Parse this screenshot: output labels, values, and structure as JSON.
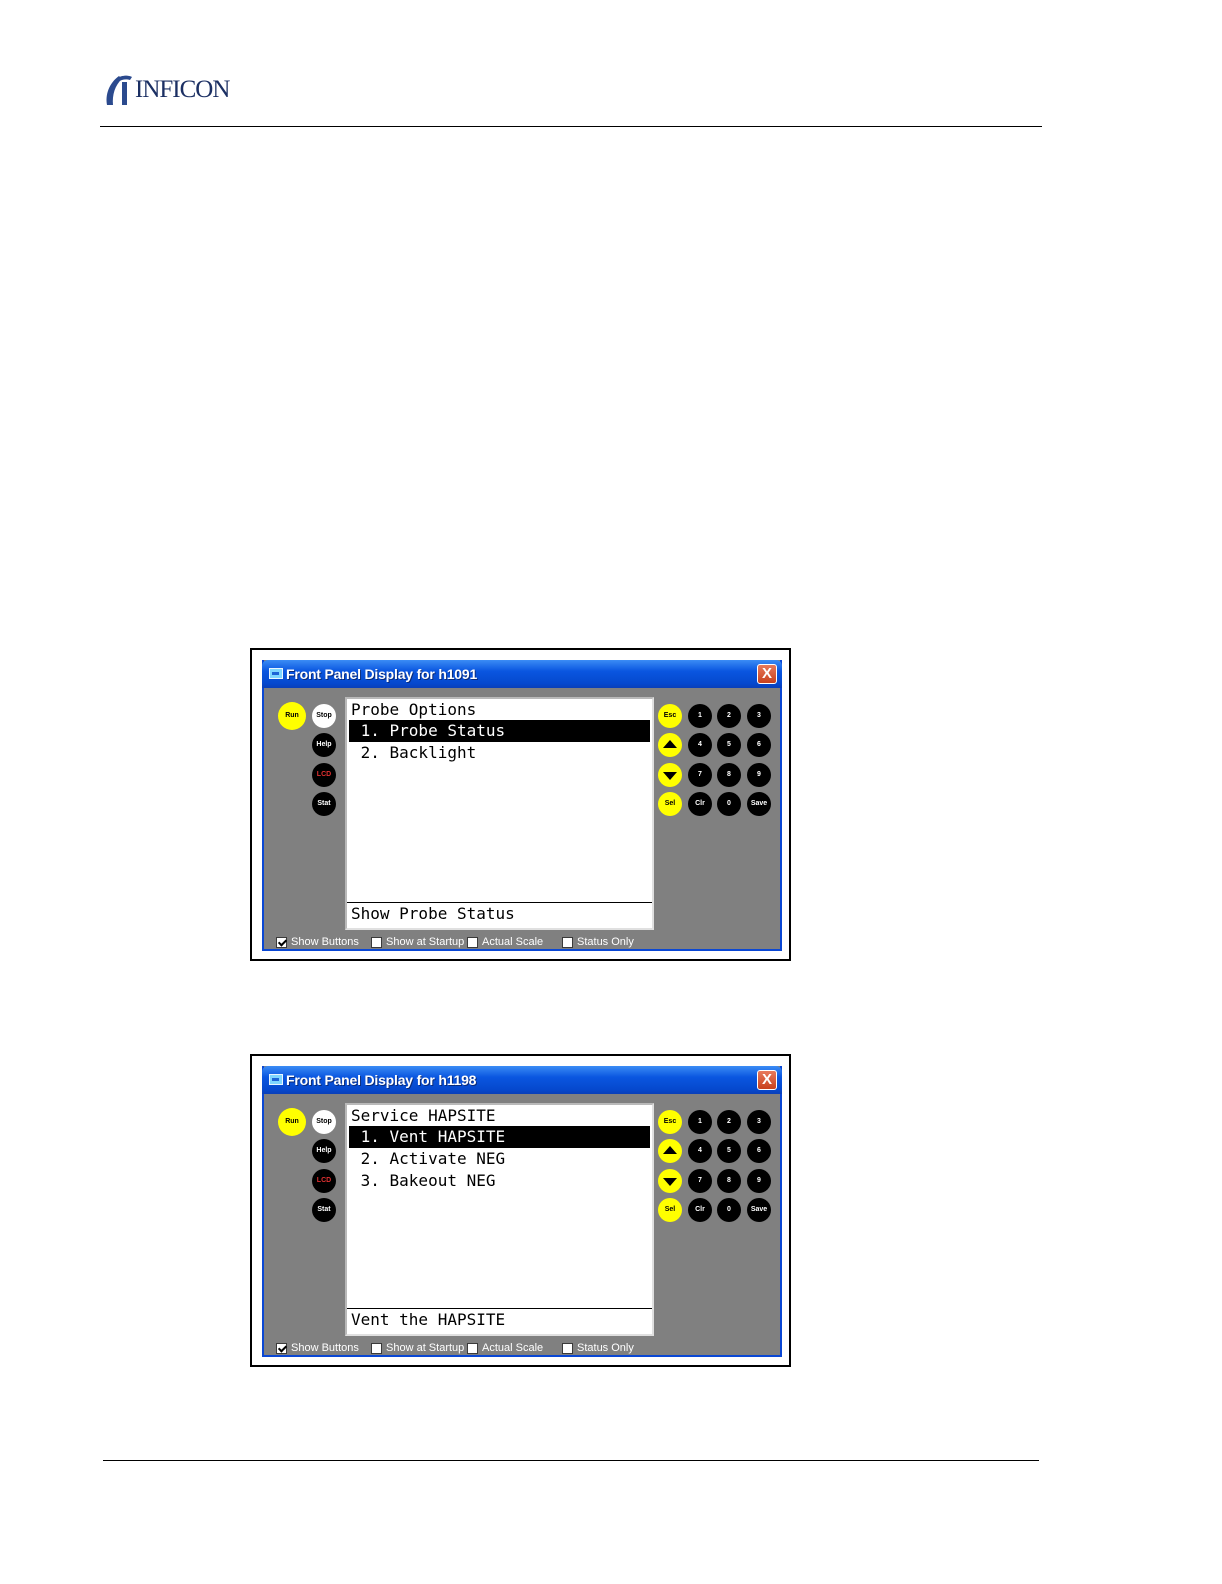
{
  "header": {
    "logo_text": "INFICON",
    "logo_icon": "inficon-mark-icon"
  },
  "windows": [
    {
      "title": "Front Panel Display for h1091",
      "close_label": "X",
      "left_buttons": {
        "run": "Run",
        "stop": "Stop",
        "help": "Help",
        "lcd": "LCD",
        "stat": "Stat"
      },
      "keypad": {
        "esc": "Esc",
        "k1": "1",
        "k2": "2",
        "k3": "3",
        "k4": "4",
        "k5": "5",
        "k6": "6",
        "k7": "7",
        "k8": "8",
        "k9": "9",
        "sel": "Sel",
        "clr": "Clr",
        "k0": "0",
        "save": "Save"
      },
      "screen": {
        "heading": "Probe Options",
        "lines": [
          " 1. Probe Status",
          " 2. Backlight"
        ],
        "selected_index": 0,
        "footer": "Show Probe Status"
      },
      "checkboxes": [
        {
          "label": "Show Buttons",
          "checked": true
        },
        {
          "label": "Show at Startup",
          "checked": false
        },
        {
          "label": "Actual Scale",
          "checked": false
        },
        {
          "label": "Status Only",
          "checked": false
        }
      ]
    },
    {
      "title": "Front Panel Display for h1198",
      "close_label": "X",
      "left_buttons": {
        "run": "Run",
        "stop": "Stop",
        "help": "Help",
        "lcd": "LCD",
        "stat": "Stat"
      },
      "keypad": {
        "esc": "Esc",
        "k1": "1",
        "k2": "2",
        "k3": "3",
        "k4": "4",
        "k5": "5",
        "k6": "6",
        "k7": "7",
        "k8": "8",
        "k9": "9",
        "sel": "Sel",
        "clr": "Clr",
        "k0": "0",
        "save": "Save"
      },
      "screen": {
        "heading": "Service HAPSITE",
        "lines": [
          " 1. Vent HAPSITE",
          " 2. Activate NEG",
          " 3. Bakeout NEG"
        ],
        "selected_index": 0,
        "footer": "Vent the HAPSITE"
      },
      "checkboxes": [
        {
          "label": "Show Buttons",
          "checked": true
        },
        {
          "label": "Show at Startup",
          "checked": false
        },
        {
          "label": "Actual Scale",
          "checked": false
        },
        {
          "label": "Status Only",
          "checked": false
        }
      ]
    }
  ]
}
